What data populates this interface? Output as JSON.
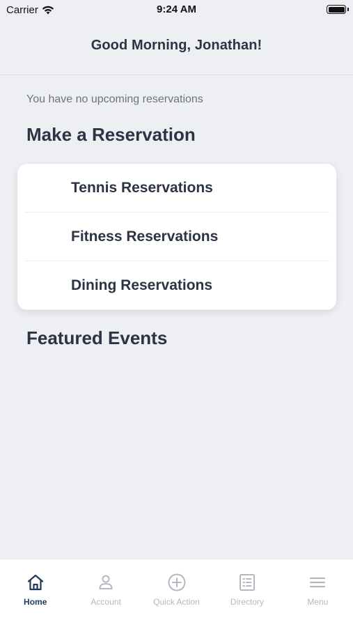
{
  "status_bar": {
    "carrier": "Carrier",
    "time": "9:24 AM",
    "battery_level": 1.0
  },
  "header": {
    "greeting": "Good Morning, Jonathan!"
  },
  "main": {
    "no_reservations_text": "You have no upcoming reservations",
    "make_reservation_title": "Make a Reservation",
    "reservation_items": [
      {
        "label": "Tennis Reservations"
      },
      {
        "label": "Fitness Reservations"
      },
      {
        "label": "Dining Reservations"
      }
    ],
    "featured_events_title": "Featured Events"
  },
  "tab_bar": {
    "active": "home",
    "tabs": [
      {
        "label": "Home",
        "icon": "home-icon"
      },
      {
        "label": "Account",
        "icon": "person-icon"
      },
      {
        "label": "Quick Action",
        "icon": "plus-circle-icon"
      },
      {
        "label": "Directory",
        "icon": "list-icon"
      },
      {
        "label": "Menu",
        "icon": "hamburger-icon"
      }
    ]
  },
  "colors": {
    "background": "#edeff3",
    "text_primary": "#2b3444",
    "text_secondary": "#6d7480",
    "tab_active": "#1f3a5c",
    "tab_inactive": "#b3b8c0"
  }
}
